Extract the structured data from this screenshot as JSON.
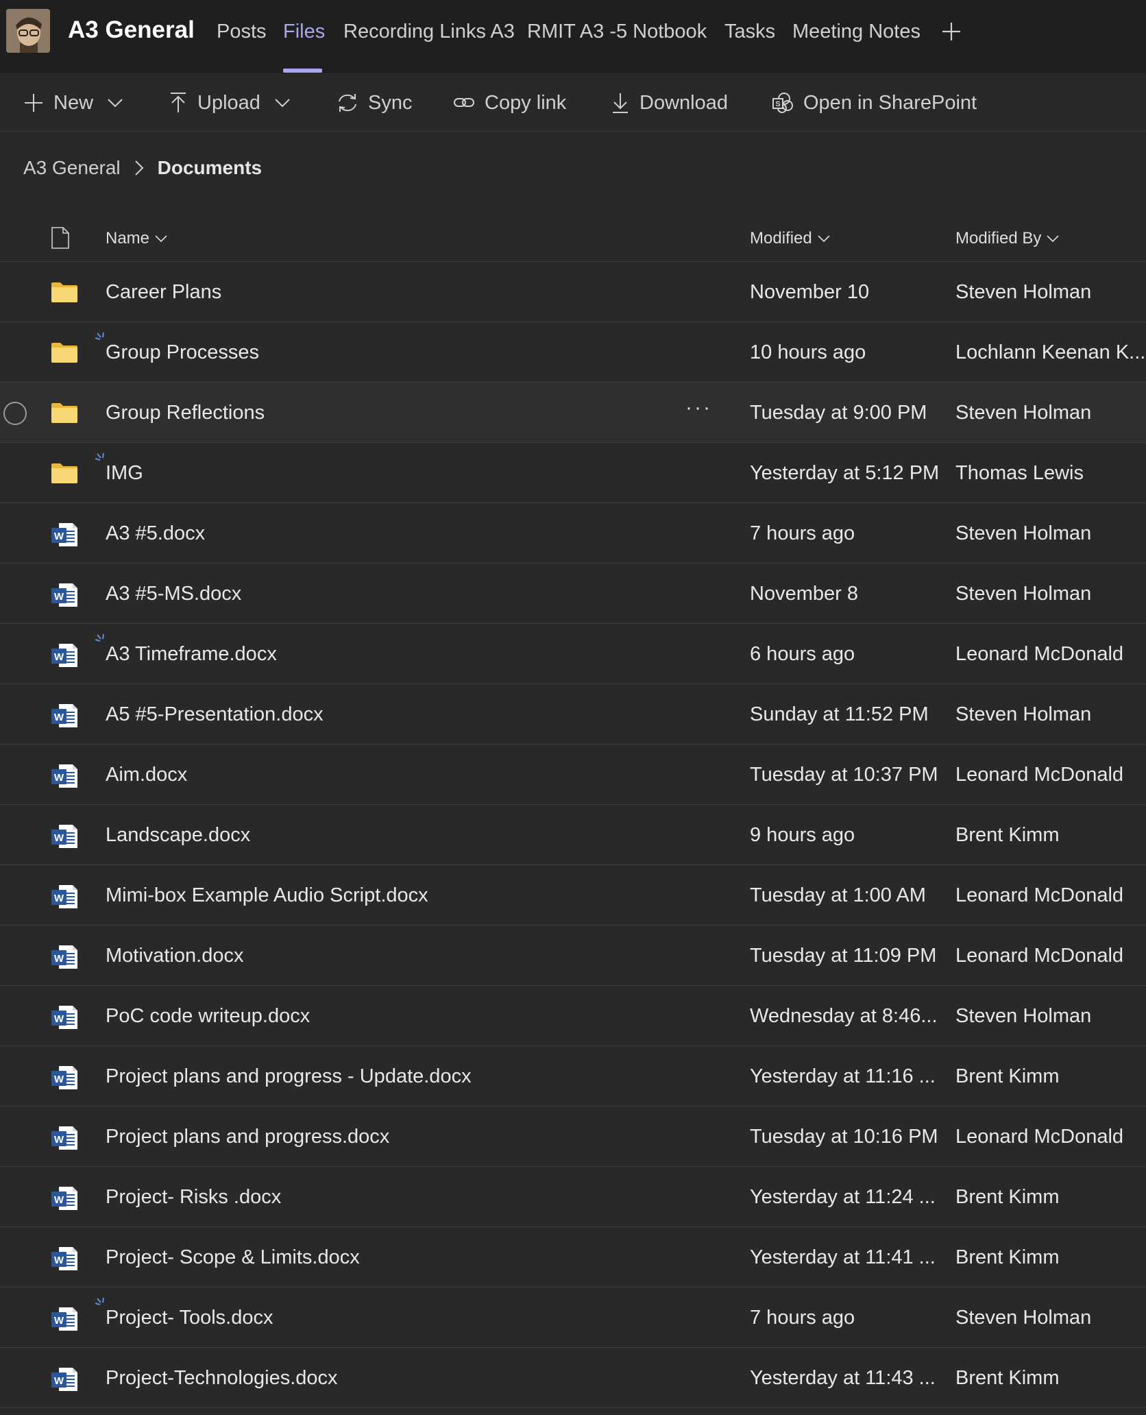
{
  "header": {
    "team_title": "A3 General",
    "tabs": [
      {
        "label": "Posts",
        "active": false
      },
      {
        "label": "Files",
        "active": true
      },
      {
        "label": "Recording Links A3",
        "active": false
      },
      {
        "label": "RMIT A3 -5 Notbook",
        "active": false
      },
      {
        "label": "Tasks",
        "active": false
      },
      {
        "label": "Meeting Notes",
        "active": false
      }
    ],
    "add_tab_icon": "plus-icon",
    "accent_color": "#a9a6ee"
  },
  "toolbar": {
    "new_label": "New",
    "upload_label": "Upload",
    "sync_label": "Sync",
    "copy_link_label": "Copy link",
    "download_label": "Download",
    "sharepoint_label": "Open in SharePoint"
  },
  "breadcrumb": {
    "parent": "A3 General",
    "current": "Documents"
  },
  "columns": {
    "name": "Name",
    "modified": "Modified",
    "modified_by": "Modified By"
  },
  "files": [
    {
      "type": "folder",
      "name": "Career Plans",
      "modified": "November 10",
      "modified_by": "Steven Holman",
      "new": false
    },
    {
      "type": "folder",
      "name": "Group Processes",
      "modified": "10 hours ago",
      "modified_by": "Lochlann Keenan K...",
      "new": true
    },
    {
      "type": "folder",
      "name": "Group Reflections",
      "modified": "Tuesday at 9:00 PM",
      "modified_by": "Steven Holman",
      "new": false,
      "hovered": true
    },
    {
      "type": "folder",
      "name": "IMG",
      "modified": "Yesterday at 5:12 PM",
      "modified_by": "Thomas Lewis",
      "new": true
    },
    {
      "type": "docx",
      "name": "A3 #5.docx",
      "modified": "7 hours ago",
      "modified_by": "Steven Holman",
      "new": false
    },
    {
      "type": "docx",
      "name": "A3 #5-MS.docx",
      "modified": "November 8",
      "modified_by": "Steven Holman",
      "new": false
    },
    {
      "type": "docx",
      "name": "A3 Timeframe.docx",
      "modified": "6 hours ago",
      "modified_by": "Leonard McDonald",
      "new": true
    },
    {
      "type": "docx",
      "name": "A5 #5-Presentation.docx",
      "modified": "Sunday at 11:52 PM",
      "modified_by": "Steven Holman",
      "new": false
    },
    {
      "type": "docx",
      "name": "Aim.docx",
      "modified": "Tuesday at 10:37 PM",
      "modified_by": "Leonard McDonald",
      "new": false
    },
    {
      "type": "docx",
      "name": "Landscape.docx",
      "modified": "9 hours ago",
      "modified_by": "Brent Kimm",
      "new": false
    },
    {
      "type": "docx",
      "name": "Mimi-box Example Audio Script.docx",
      "modified": "Tuesday at 1:00 AM",
      "modified_by": "Leonard McDonald",
      "new": false
    },
    {
      "type": "docx",
      "name": "Motivation.docx",
      "modified": "Tuesday at 11:09 PM",
      "modified_by": "Leonard McDonald",
      "new": false
    },
    {
      "type": "docx",
      "name": "PoC code writeup.docx",
      "modified": "Wednesday at 8:46...",
      "modified_by": "Steven Holman",
      "new": false
    },
    {
      "type": "docx",
      "name": "Project plans and progress - Update.docx",
      "modified": "Yesterday at 11:16 ...",
      "modified_by": "Brent Kimm",
      "new": false
    },
    {
      "type": "docx",
      "name": "Project plans and progress.docx",
      "modified": "Tuesday at 10:16 PM",
      "modified_by": "Leonard McDonald",
      "new": false
    },
    {
      "type": "docx",
      "name": "Project- Risks .docx",
      "modified": "Yesterday at 11:24 ...",
      "modified_by": "Brent Kimm",
      "new": false
    },
    {
      "type": "docx",
      "name": "Project- Scope & Limits.docx",
      "modified": "Yesterday at 11:41 ...",
      "modified_by": "Brent Kimm",
      "new": false
    },
    {
      "type": "docx",
      "name": "Project- Tools.docx",
      "modified": "7 hours ago",
      "modified_by": "Steven Holman",
      "new": true
    },
    {
      "type": "docx",
      "name": "Project-Technologies.docx",
      "modified": "Yesterday at 11:43 ...",
      "modified_by": "Brent Kimm",
      "new": false
    }
  ],
  "more_options_label": "···",
  "colors": {
    "background": "#292929",
    "header_bg": "#1f1f1f",
    "folder": "#f8d775",
    "word_blue": "#2b579a",
    "new_marker": "#5b8fd6"
  }
}
